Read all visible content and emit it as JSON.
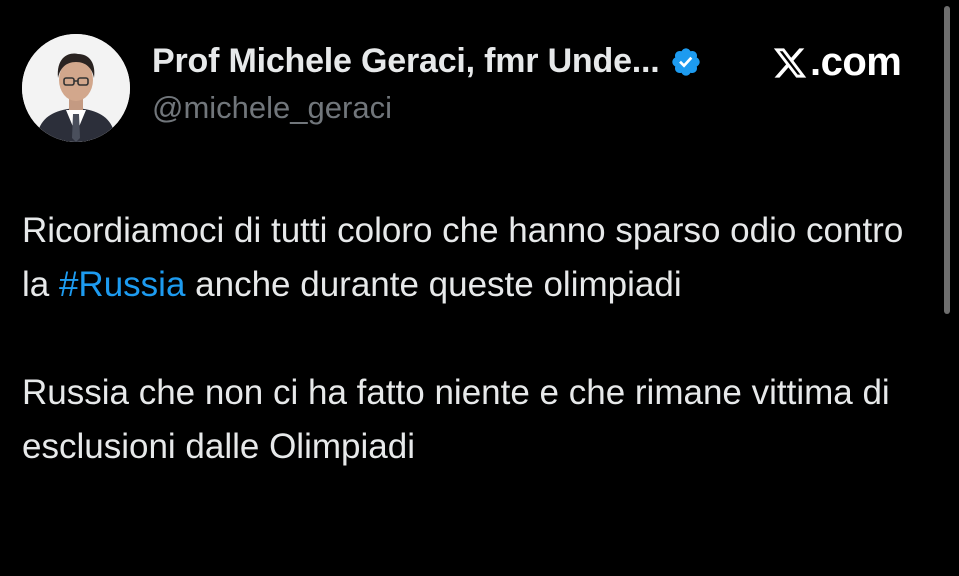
{
  "tweet": {
    "author": {
      "display_name": "Prof Michele Geraci, fmr Unde...",
      "handle": "@michele_geraci",
      "verified_icon": "verified-badge-icon",
      "avatar": "profile-photo"
    },
    "source_brand": {
      "icon": "x-logo-icon",
      "text": ".com"
    },
    "paragraphs": [
      {
        "before": "Ricordiamoci di tutti coloro che hanno sparso odio contro la ",
        "hashtag": "#Russia",
        "after": " anche durante queste olimpiadi"
      },
      {
        "text": "Russia che non ci ha fatto niente e che rimane vittima di esclusioni dalle Olimpiadi"
      }
    ]
  },
  "colors": {
    "background": "#000000",
    "text": "#e7e9ea",
    "secondary_text": "#71767b",
    "link": "#1d9bf0",
    "verified": "#1d9bf0"
  }
}
